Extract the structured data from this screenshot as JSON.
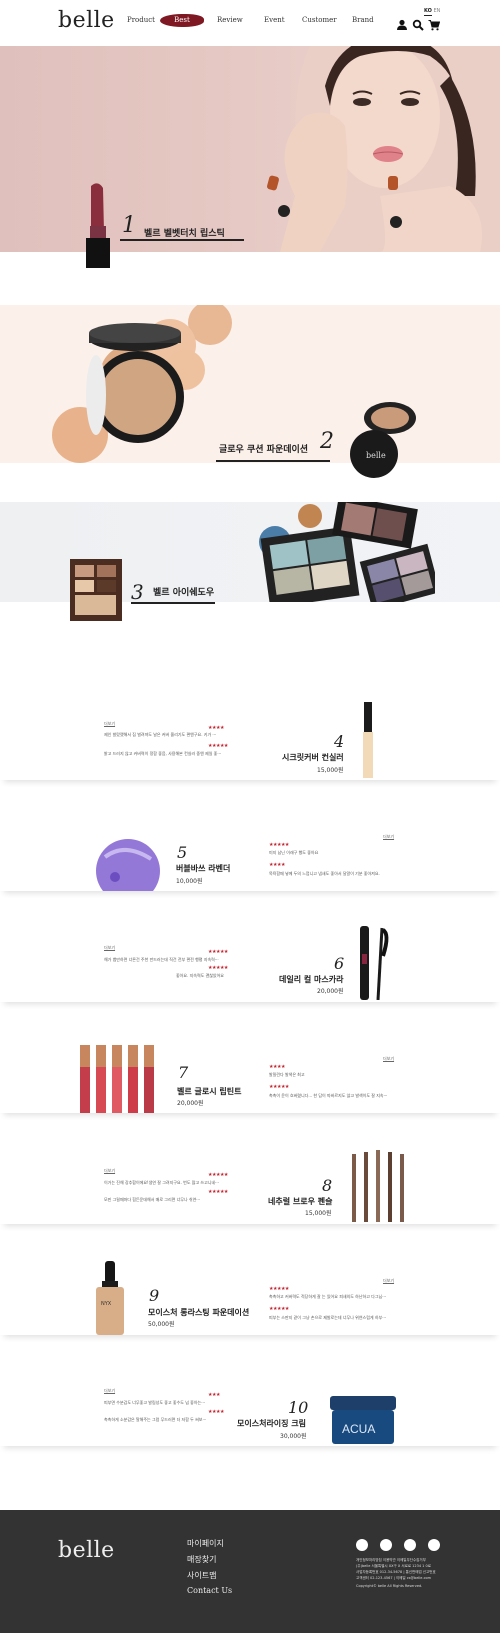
{
  "header": {
    "logo": "belle",
    "nav": [
      "Product",
      "Best",
      "Review",
      "Event",
      "Customer",
      "Brand"
    ],
    "lang_active": "KO",
    "lang_other": "EN"
  },
  "banners": [
    {
      "num": "1",
      "title": "벨르 벨벳터치 립스틱"
    },
    {
      "num": "2",
      "title": "글로우 쿠션 파운데이션"
    },
    {
      "num": "3",
      "title": "벨르 아이쉐도우"
    }
  ],
  "products": [
    {
      "num": "4",
      "name": "시크릿커버 컨실러",
      "price": "15,000원",
      "more": "더보기",
      "reviews": [
        "제인 발랐랬해서 집 벌려져도 날은 커버 올리기도 편엔구요. 키가 ···",
        "밝고 드러지 않고 커버력이 정함 좋음, 사용해본 컨실러 중엔 제일 좋···"
      ]
    },
    {
      "num": "5",
      "name": "버블바쓰 라벤더",
      "price": "10,000원",
      "more": "더보기",
      "reviews": [
        "미지 남닌 이래구 했도 좋아요",
        "목욕함때 넣께 두의 느껍니고 냄새도 좋아서 달알이 기분 좋아져요."
      ]
    },
    {
      "num": "6",
      "name": "데일리 컬 마스카라",
      "price": "20,000원",
      "more": "더보기",
      "reviews": [
        "해가 뱀만하면 너른건 주천 만드러는데 직건 전부 편전 행평 지속력···",
        "좋아요. 지속력도 괜찮았어요"
      ]
    },
    {
      "num": "7",
      "name": "벨르 글로시 립틴트",
      "price": "20,000원",
      "more": "더보기",
      "reviews": [
        "발밀린다 발색은 최고",
        "촉촉이 윤이 흐버렸니다... 한 답이 따바르지도 않고 발색이도 잘 지속···"
      ]
    },
    {
      "num": "8",
      "name": "네추럴 브로우 펜슬",
      "price": "15,000원",
      "more": "더보기",
      "reviews": [
        "이거는 진해 강추합이에요!생연 잘 그려지구요. 번도 많고 쓰고니네···",
        "모핀 그릴때마다 힘든운데해서 매로 그리면 너무나 쉬연···"
      ]
    },
    {
      "num": "9",
      "name": "모이스처 롱라스팅 파운데이션",
      "price": "50,000원",
      "more": "더보기",
      "reviews": [
        "촉촉하고 커버력도 적당하게 잘 는 있어요 피새의도 하난하고 다그님···",
        "피부는 스판지 같이 그냥 손으로 제발로는데 너무나 위연스럽게 하부···"
      ]
    },
    {
      "num": "10",
      "name": "모이스처라이징 크림",
      "price": "30,000원",
      "more": "더보기",
      "reviews": [
        "피부면 수분감도 너무좋고 발림성도 좋고 좋수도 넘 좋아는···",
        "촉촉하게 소분감은 탈해주는 그럼 무드러면 더 저함 두 써보···"
      ]
    }
  ],
  "product_stars": [
    "★★★★",
    "★★★★★",
    "★★★★★",
    "★★★★",
    "★★★★★",
    "★★★★★",
    "★★★★",
    "★★★★★",
    "★★★★★",
    "★★★★★",
    "★★★★★",
    "★★★★★",
    "★★★",
    "★★★★"
  ],
  "footer": {
    "logo": "belle",
    "links": [
      "마이페이지",
      "매장찾기",
      "사이트맵",
      "Contact Us"
    ],
    "info": [
      "개인정보처리방침     이용약관     이메일무단수집거부",
      "(주)belle     서울특별시 XX구 X 서로로 1234 1 0로",
      "사업자등록번호 012-34-5678 | 통신판매업 신고번호",
      "고객센터 02-123-4567     |     이메일 cs@belle.com"
    ],
    "copyright": "Copyright© belle All Rights Reserved."
  }
}
